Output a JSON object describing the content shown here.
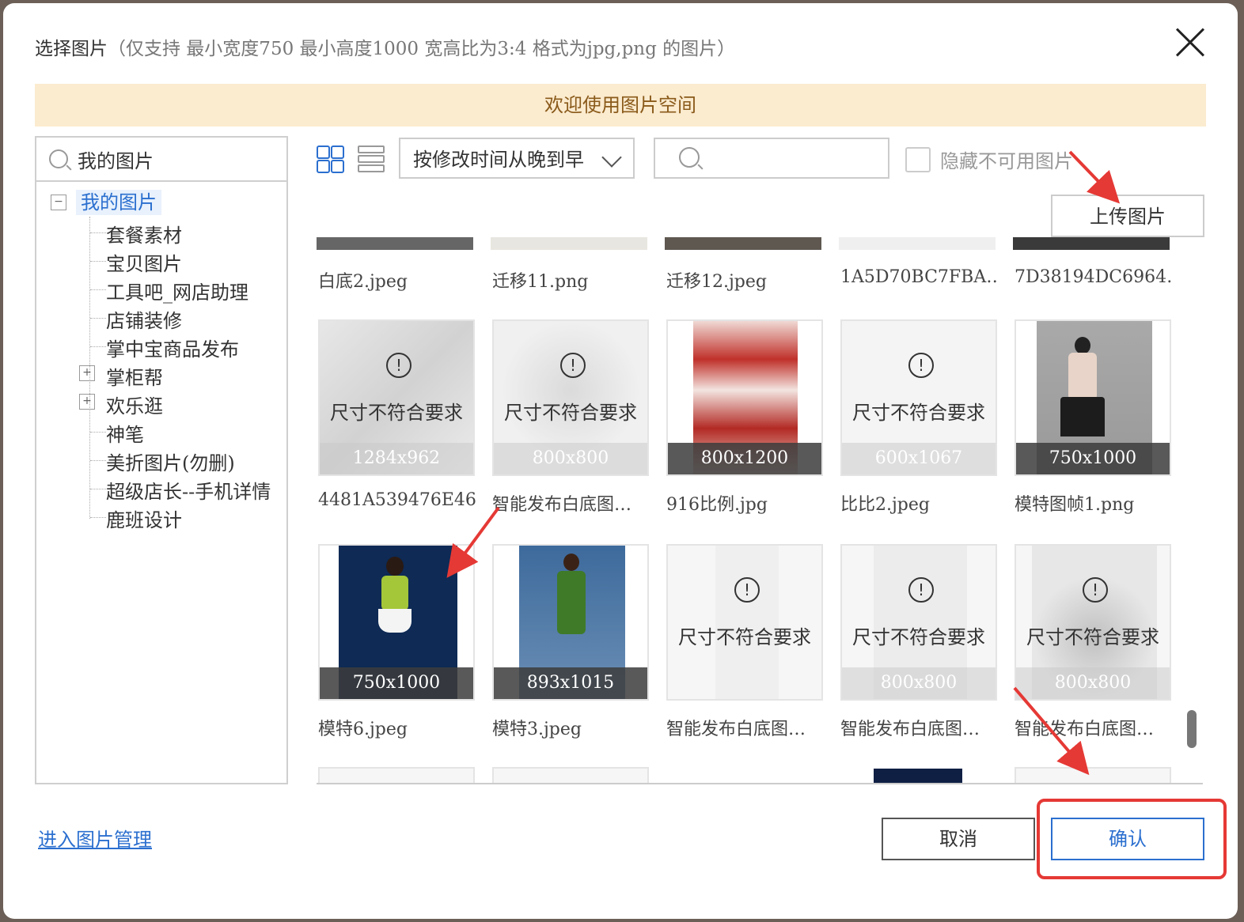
{
  "dialog": {
    "title": "选择图片",
    "hint": "（仅支持 最小宽度750 最小高度1000 宽高比为3:4 格式为jpg,png 的图片）",
    "banner": "欢迎使用图片空间"
  },
  "sidebar": {
    "search_label": "我的图片",
    "root": "我的图片",
    "items": [
      {
        "label": "套餐素材"
      },
      {
        "label": "宝贝图片"
      },
      {
        "label": "工具吧_网店助理"
      },
      {
        "label": "店铺装修"
      },
      {
        "label": "掌中宝商品发布"
      },
      {
        "label": "掌柜帮"
      },
      {
        "label": "欢乐逛"
      },
      {
        "label": "神笔"
      },
      {
        "label": "美折图片(勿删)"
      },
      {
        "label": "超级店长--手机详情"
      },
      {
        "label": "鹿班设计"
      }
    ]
  },
  "toolbar": {
    "sort_label": "按修改时间从晚到早",
    "search_placeholder": "",
    "hide_unavailable": "隐藏不可用图片",
    "upload": "上传图片"
  },
  "gallery": {
    "row1_names": [
      "白底2.jpeg",
      "迁移11.png",
      "迁移12.jpeg",
      "1A5D70BC7FBA…",
      "7D38194DC6964…"
    ],
    "row2": [
      {
        "dim": "1284x962",
        "warn": "尺寸不符合要求",
        "name": "4481A539476E46…"
      },
      {
        "dim": "800x800",
        "warn": "尺寸不符合要求",
        "name": "智能发布白底图…"
      },
      {
        "dim": "800x1200",
        "warn": "",
        "name": "916比例.jpg"
      },
      {
        "dim": "600x1067",
        "warn": "尺寸不符合要求",
        "name": "比比2.jpeg"
      },
      {
        "dim": "750x1000",
        "warn": "",
        "name": "模特图帧1.png"
      }
    ],
    "row3": [
      {
        "dim": "750x1000",
        "warn": "",
        "name": "模特6.jpeg"
      },
      {
        "dim": "893x1015",
        "warn": "",
        "name": "模特3.jpeg"
      },
      {
        "dim": "",
        "warn": "尺寸不符合要求",
        "name": "智能发布白底图…"
      },
      {
        "dim": "800x800",
        "warn": "尺寸不符合要求",
        "name": "智能发布白底图…"
      },
      {
        "dim": "800x800",
        "warn": "尺寸不符合要求",
        "name": "智能发布白底图…"
      }
    ],
    "warn_icon": "!"
  },
  "footer": {
    "manage_link": "进入图片管理",
    "cancel": "取消",
    "confirm": "确认"
  },
  "colors": {
    "accent": "#2b6fcf",
    "banner_bg": "#fbebcf",
    "annotation": "#e53935"
  }
}
